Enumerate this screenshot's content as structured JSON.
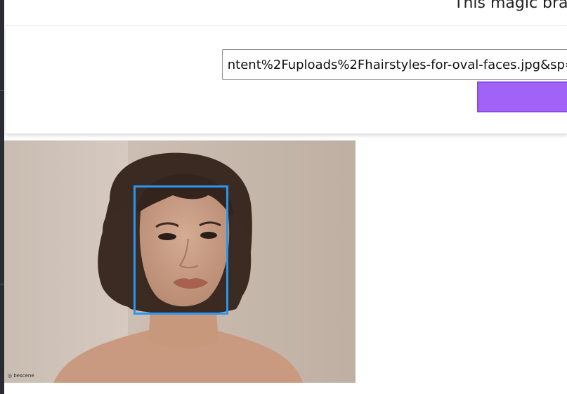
{
  "header": {
    "title": "This magic brai"
  },
  "form": {
    "url_value": "ntent%2Fuploads%2Fhairstyles-for-oval-faces.jpg&sp=",
    "submit_label": ""
  },
  "image": {
    "watermark": "bescene"
  },
  "colors": {
    "accent": "#a162f7",
    "face_box": "#2a96f0",
    "sidebar": "#2a2b33"
  }
}
